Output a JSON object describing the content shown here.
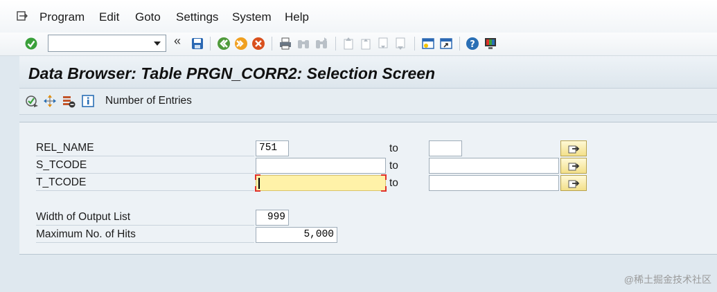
{
  "menu": {
    "items": [
      {
        "label": "Program"
      },
      {
        "label": "Edit"
      },
      {
        "label": "Goto"
      },
      {
        "label": "Settings"
      },
      {
        "label": "System"
      },
      {
        "label": "Help"
      }
    ]
  },
  "toolbar": {
    "command_field_value": "",
    "collapse_glyph": "«"
  },
  "title": "Data Browser: Table PRGN_CORR2: Selection Screen",
  "app_toolbar": {
    "number_of_entries_label": "Number of Entries"
  },
  "selection": {
    "rows": [
      {
        "label": "REL_NAME",
        "from": "751",
        "to_label": "to",
        "to": ""
      },
      {
        "label": "S_TCODE",
        "from": "",
        "to_label": "to",
        "to": ""
      },
      {
        "label": "T_TCODE",
        "from": "",
        "to_label": "to",
        "to": ""
      }
    ],
    "width_label": "Width of Output List",
    "width_value": "999",
    "max_hits_label": "Maximum No. of Hits",
    "max_hits_value": "5,000"
  },
  "watermark": "@稀土掘金技术社区",
  "colors": {
    "focused_field": "#fff2a8",
    "focus_corner": "#e0302a",
    "enter_icon": "#3aa03a",
    "help_icon": "#2a6fb5"
  }
}
